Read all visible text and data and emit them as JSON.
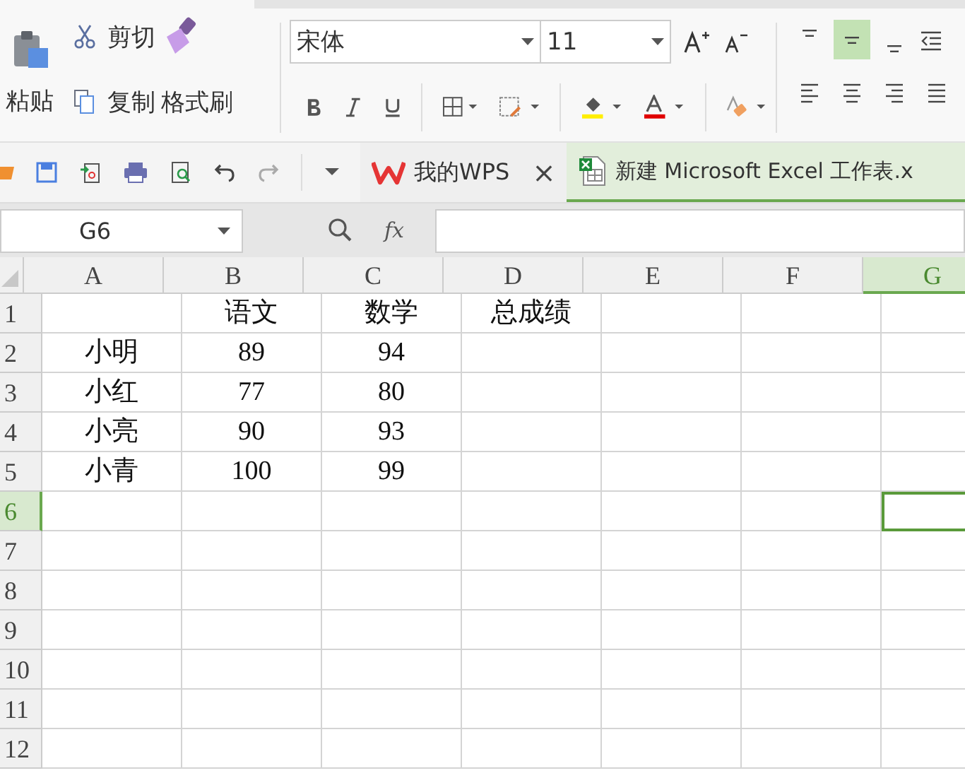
{
  "ribbon": {
    "clipboard": {
      "paste": "粘贴",
      "cut": "剪切",
      "copy": "复制",
      "format_painter": "格式刷"
    },
    "font": {
      "name": "宋体",
      "size": "11"
    },
    "vertical_align": [
      {
        "kind": "top",
        "selected": false
      },
      {
        "kind": "middle",
        "selected": true
      },
      {
        "kind": "bottom",
        "selected": false
      }
    ],
    "horizontal_align": [
      {
        "kind": "left",
        "selected": false
      },
      {
        "kind": "center",
        "selected": false
      },
      {
        "kind": "right",
        "selected": false
      },
      {
        "kind": "justify",
        "selected": false
      }
    ]
  },
  "tabs": [
    {
      "label": "我的WPS",
      "kind": "home",
      "selected": false,
      "close": "×"
    },
    {
      "label": "新建 Microsoft Excel 工作表.x",
      "kind": "sheet",
      "selected": true
    }
  ],
  "formula_bar": {
    "name_box": "G6",
    "fx": "fx"
  },
  "sheet": {
    "columns": [
      {
        "label": "A",
        "selected": false
      },
      {
        "label": "B",
        "selected": false
      },
      {
        "label": "C",
        "selected": false
      },
      {
        "label": "D",
        "selected": false
      },
      {
        "label": "E",
        "selected": false
      },
      {
        "label": "F",
        "selected": false
      },
      {
        "label": "G",
        "selected": true
      }
    ],
    "rows": [
      {
        "label": "1",
        "selected": false,
        "cells": [
          "",
          "语文",
          "数学",
          "总成绩"
        ]
      },
      {
        "label": "2",
        "selected": false,
        "cells": [
          "小明",
          "89",
          "94"
        ]
      },
      {
        "label": "3",
        "selected": false,
        "cells": [
          "小红",
          "77",
          "80"
        ]
      },
      {
        "label": "4",
        "selected": false,
        "cells": [
          "小亮",
          "90",
          "93"
        ]
      },
      {
        "label": "5",
        "selected": false,
        "cells": [
          "小青",
          "100",
          "99"
        ]
      },
      {
        "label": "6",
        "selected": true,
        "cells": []
      },
      {
        "label": "7",
        "selected": false,
        "cells": []
      },
      {
        "label": "8",
        "selected": false,
        "cells": []
      },
      {
        "label": "9",
        "selected": false,
        "cells": []
      },
      {
        "label": "10",
        "selected": false,
        "cells": []
      },
      {
        "label": "11",
        "selected": false,
        "cells": []
      },
      {
        "label": "12",
        "selected": false,
        "cells": []
      }
    ]
  }
}
